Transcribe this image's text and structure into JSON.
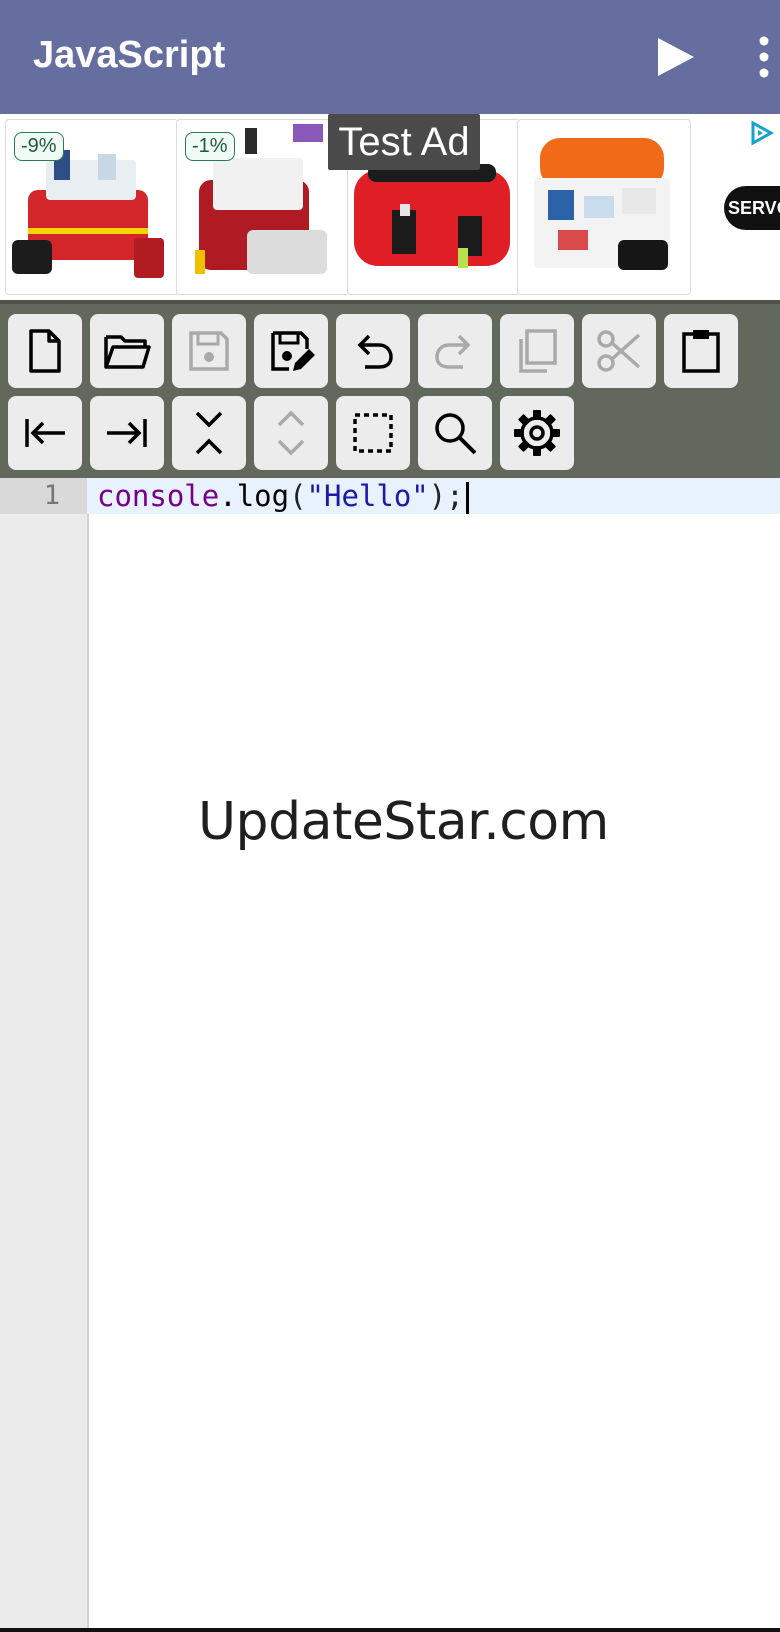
{
  "appbar": {
    "title": "JavaScript",
    "run_icon": "play-icon",
    "menu_icon": "more-vert-icon",
    "color": "#656e9f"
  },
  "ad": {
    "label": "Test Ad",
    "brand": "SERVOXY",
    "products": [
      {
        "badge": "-9%"
      },
      {
        "badge": "-1%"
      },
      {
        "badge": ""
      },
      {
        "badge": ""
      }
    ]
  },
  "toolbar": {
    "rows": [
      [
        {
          "name": "new-file",
          "icon": "file-icon",
          "enabled": true
        },
        {
          "name": "open-file",
          "icon": "folder-open-icon",
          "enabled": true
        },
        {
          "name": "save",
          "icon": "save-icon",
          "enabled": false
        },
        {
          "name": "save-as",
          "icon": "save-as-icon",
          "enabled": true
        },
        {
          "name": "undo",
          "icon": "undo-icon",
          "enabled": true
        },
        {
          "name": "redo",
          "icon": "redo-icon",
          "enabled": false
        },
        {
          "name": "copy",
          "icon": "copy-icon",
          "enabled": false
        },
        {
          "name": "cut",
          "icon": "scissors-icon",
          "enabled": false
        },
        {
          "name": "paste",
          "icon": "clipboard-icon",
          "enabled": true
        }
      ],
      [
        {
          "name": "outdent",
          "icon": "outdent-icon",
          "enabled": true
        },
        {
          "name": "indent",
          "icon": "indent-icon",
          "enabled": true
        },
        {
          "name": "collapse",
          "icon": "collapse-icon",
          "enabled": true
        },
        {
          "name": "expand",
          "icon": "expand-icon",
          "enabled": false
        },
        {
          "name": "select-all",
          "icon": "select-all-icon",
          "enabled": true
        },
        {
          "name": "search",
          "icon": "search-icon",
          "enabled": true
        },
        {
          "name": "settings",
          "icon": "gear-icon",
          "enabled": true
        }
      ]
    ]
  },
  "editor": {
    "line_number": "1",
    "code": {
      "obj": "console",
      "dot": ".",
      "method": "log",
      "open": "(",
      "string": "\"Hello\"",
      "close": ");"
    }
  },
  "watermark": "UpdateStar.com"
}
